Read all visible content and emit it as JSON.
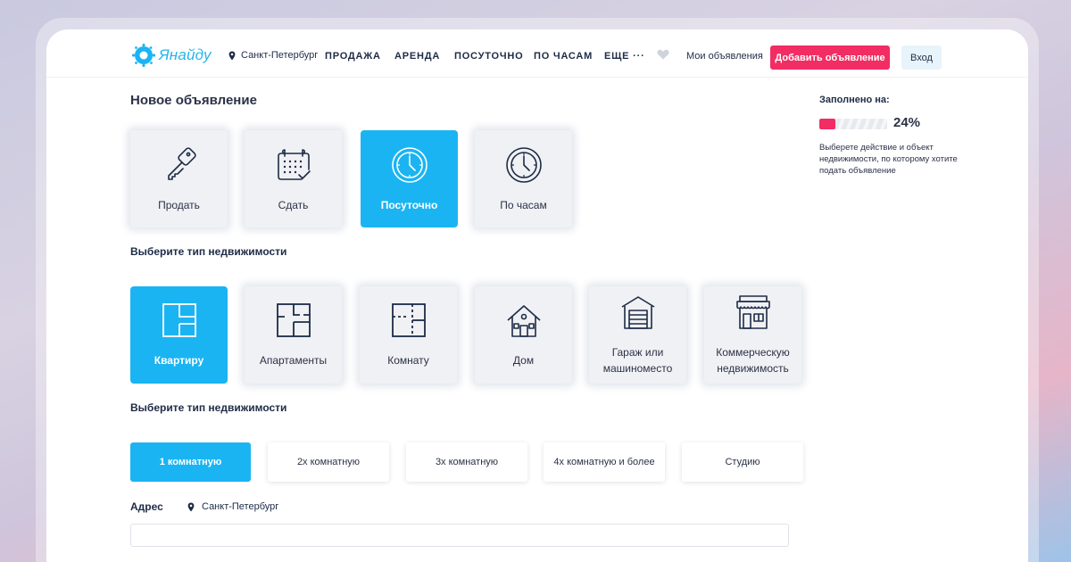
{
  "header": {
    "logo_text": "Янайду",
    "city": "Санкт-Петербург",
    "nav": [
      "ПРОДАЖА",
      "АРЕНДА",
      "ПОСУТОЧНО",
      "ПО ЧАСАМ",
      "ЕЩЕ ···"
    ],
    "my_ads": "Мои объявления",
    "add_button": "Добавить объявление",
    "login_button": "Вход"
  },
  "page_title": "Новое объявление",
  "actions": [
    "Продать",
    "Сдать",
    "Посуточно",
    "По часам"
  ],
  "property_section_title": "Выберите тип недвижимости",
  "property_types": [
    "Квартиру",
    "Апартаменты",
    "Комнату",
    "Дом",
    "Гараж или машиноместо",
    "Коммерческую недвижимость"
  ],
  "rooms_section_title": "Выберите тип недвижимости",
  "rooms": [
    "1 комнатную",
    "2х комнатную",
    "3х комнатную",
    "4х комнатную и более",
    "Студию"
  ],
  "address": {
    "label": "Адрес",
    "city": "Санкт-Петербург",
    "value": ""
  },
  "sidebar": {
    "fill_label": "Заполнено на:",
    "percent_text": "24%",
    "progress_fraction": 0.24,
    "hint": "Выберете действие и объект недвижимости, по которому хотите подать объявление"
  },
  "colors": {
    "accent": "#1bb4f2",
    "brand_pink": "#f22d63",
    "text": "#1d2b46"
  }
}
